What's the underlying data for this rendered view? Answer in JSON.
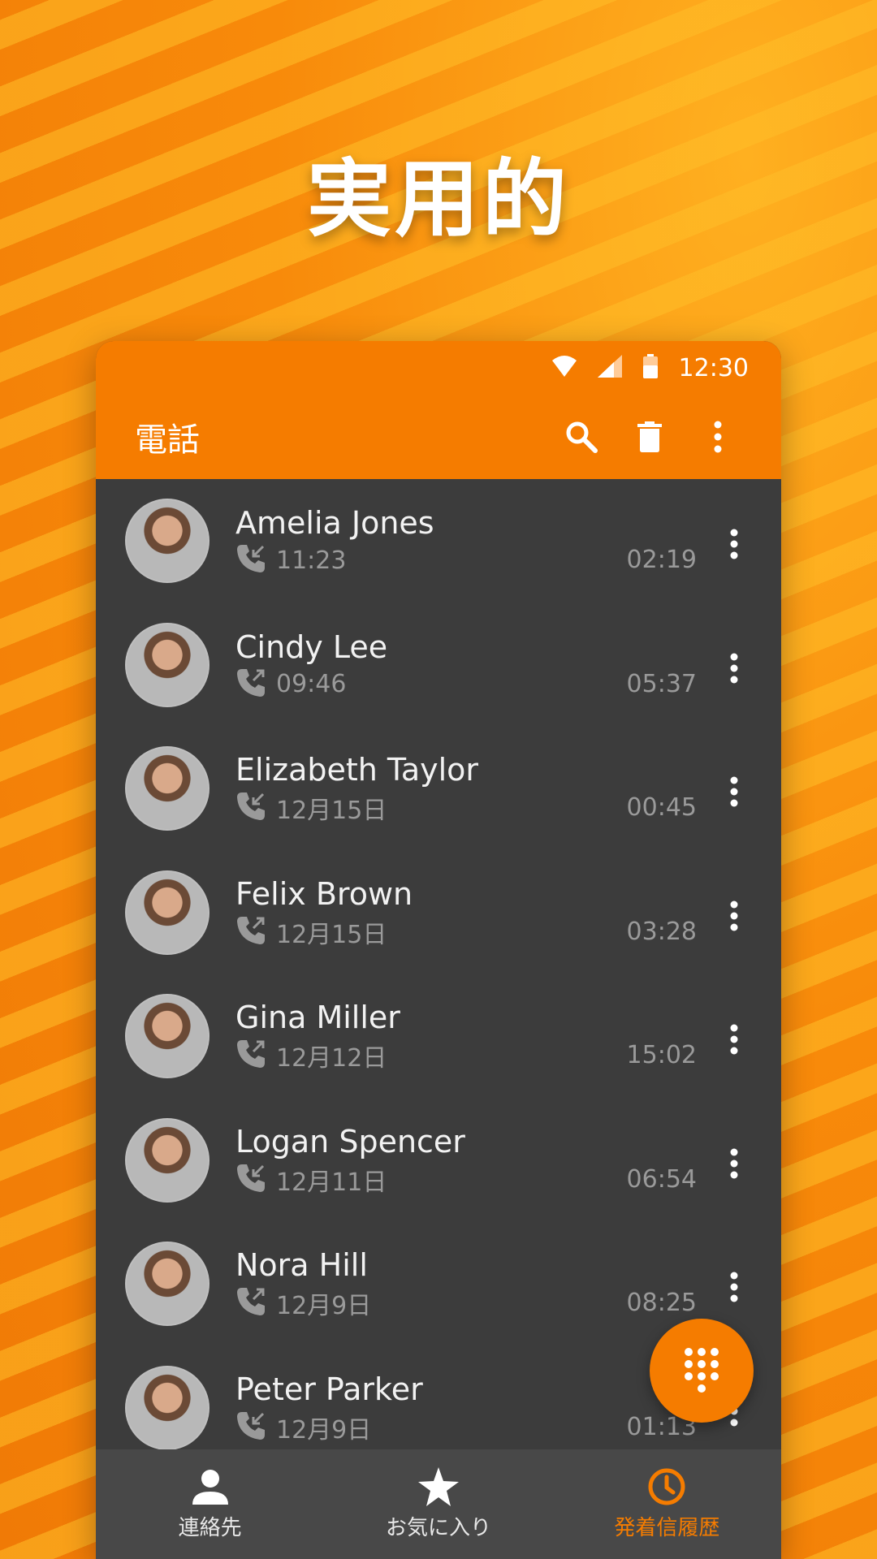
{
  "headline": "実用的",
  "status": {
    "time": "12:30"
  },
  "appbar": {
    "title": "電話",
    "icons": [
      "search-icon",
      "delete-icon",
      "more-vert-icon"
    ]
  },
  "calls": [
    {
      "name": "Amelia Jones",
      "type": "incoming",
      "time": "11:23",
      "duration": "02:19"
    },
    {
      "name": "Cindy Lee",
      "type": "outgoing",
      "time": "09:46",
      "duration": "05:37"
    },
    {
      "name": "Elizabeth Taylor",
      "type": "incoming",
      "time": "12月15日",
      "duration": "00:45"
    },
    {
      "name": "Felix Brown",
      "type": "outgoing",
      "time": "12月15日",
      "duration": "03:28"
    },
    {
      "name": "Gina Miller",
      "type": "outgoing",
      "time": "12月12日",
      "duration": "15:02"
    },
    {
      "name": "Logan Spencer",
      "type": "incoming",
      "time": "12月11日",
      "duration": "06:54"
    },
    {
      "name": "Nora Hill",
      "type": "outgoing",
      "time": "12月9日",
      "duration": "08:25"
    },
    {
      "name": "Peter Parker",
      "type": "incoming",
      "time": "12月9日",
      "duration": "01:13"
    }
  ],
  "nav": [
    {
      "label": "連絡先",
      "icon": "person-icon",
      "active": false
    },
    {
      "label": "お気に入り",
      "icon": "star-icon",
      "active": false
    },
    {
      "label": "発着信履歴",
      "icon": "clock-icon",
      "active": true
    }
  ],
  "colors": {
    "accent": "#f57c00",
    "list_bg": "#3c3c3c",
    "nav_bg": "#484848"
  }
}
